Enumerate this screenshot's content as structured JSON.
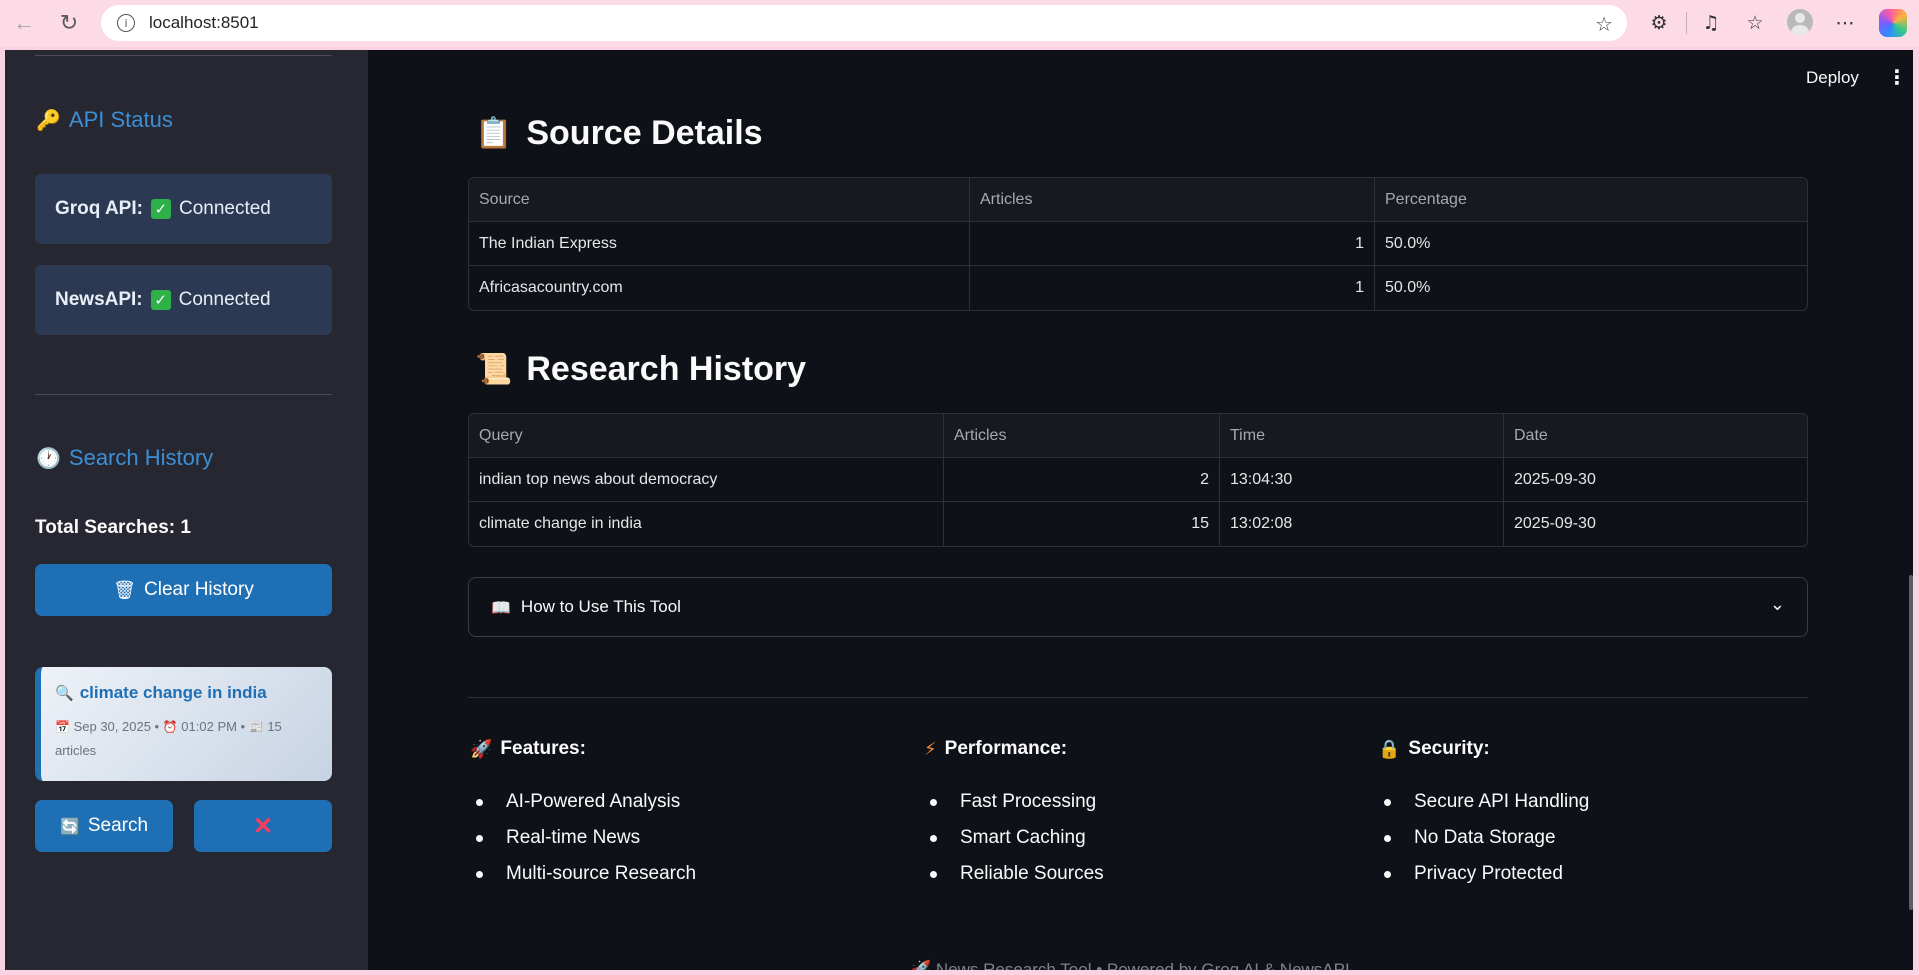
{
  "browser": {
    "url": "localhost:8501"
  },
  "header": {
    "deploy_label": "Deploy",
    "menu_icon": "⋮"
  },
  "sidebar": {
    "api_status_title": "API Status",
    "statuses": [
      {
        "name": "Groq API:",
        "value": "Connected"
      },
      {
        "name": "NewsAPI:",
        "value": "Connected"
      }
    ],
    "search_history_title": "Search History",
    "total_searches": "Total Searches: 1",
    "clear_history_label": "Clear History",
    "history_item": {
      "query": "climate change in india",
      "date": "Sep 30, 2025 •",
      "time": "01:02 PM •",
      "count": "15",
      "articles_word": "articles"
    },
    "search_button_label": "Search",
    "delete_button_label": "✕"
  },
  "source_details": {
    "title": "Source Details",
    "columns": [
      "Source",
      "Articles",
      "Percentage"
    ],
    "rows": [
      [
        "The Indian Express",
        "1",
        "50.0%"
      ],
      [
        "Africasacountry.com",
        "1",
        "50.0%"
      ]
    ]
  },
  "research_history": {
    "title": "Research History",
    "columns": [
      "Query",
      "Articles",
      "Time",
      "Date"
    ],
    "rows": [
      [
        "indian top news about democracy",
        "2",
        "13:04:30",
        "2025-09-30"
      ],
      [
        "climate change in india",
        "15",
        "13:02:08",
        "2025-09-30"
      ]
    ]
  },
  "expander": {
    "label": "How to Use This Tool"
  },
  "features": [
    {
      "title": "Features:",
      "items": [
        "AI-Powered Analysis",
        "Real-time News",
        "Multi-source Research"
      ]
    },
    {
      "title": "Performance:",
      "items": [
        "Fast Processing",
        "Smart Caching",
        "Reliable Sources"
      ]
    },
    {
      "title": "Security:",
      "items": [
        "Secure API Handling",
        "No Data Storage",
        "Privacy Protected"
      ]
    }
  ],
  "footer": {
    "text": "🚀 News Research Tool • Powered by Groq AI & NewsAPI"
  },
  "colors": {
    "accent": "#1f6fb5",
    "heading_blue": "#3a8fd6",
    "sidebar_bg": "#262730",
    "main_bg": "#0e1117",
    "status_card_bg": "#2b3a52"
  }
}
